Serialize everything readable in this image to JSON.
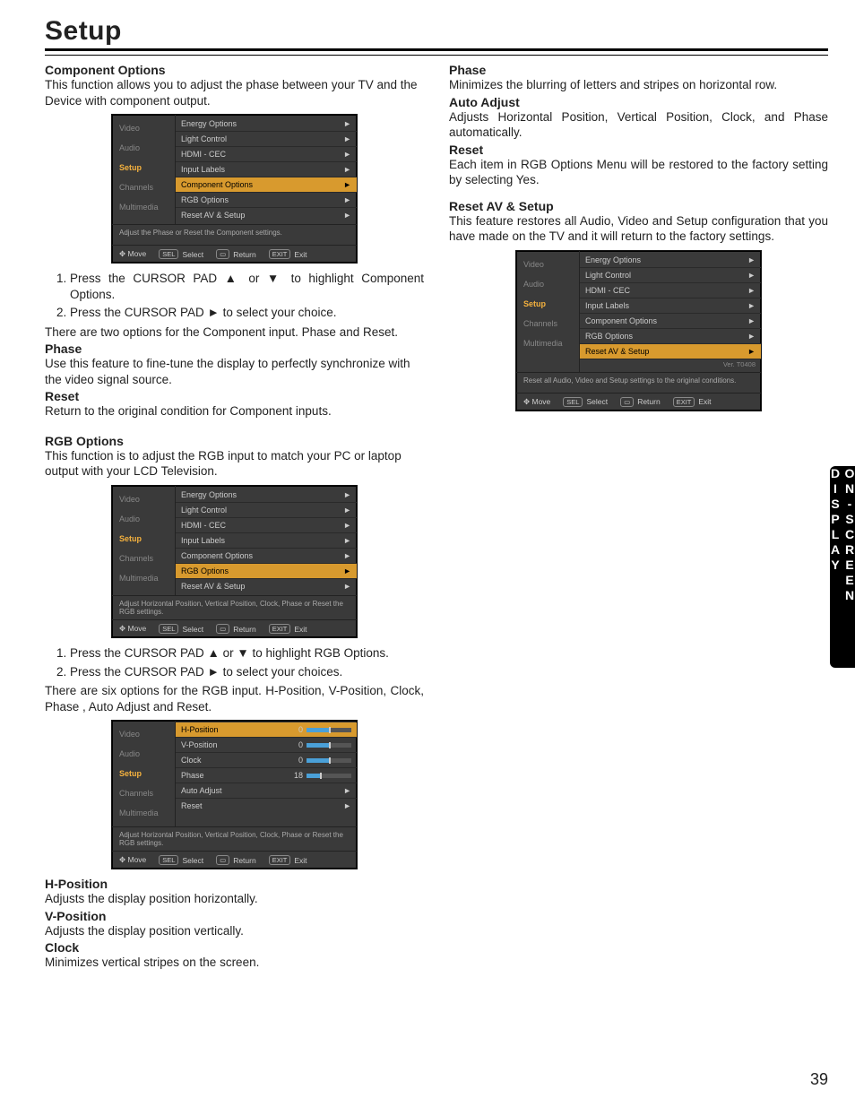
{
  "title": "Setup",
  "sideTab": "ON-SCREEN DISPLAY",
  "pageNumber": "39",
  "osdNav": {
    "move": "Move",
    "select": "Select",
    "return": "Return",
    "exit": "Exit",
    "keySel": "SEL",
    "keyExit": "EXIT"
  },
  "sideMenu": [
    "Video",
    "Audio",
    "Setup",
    "Channels",
    "Multimedia"
  ],
  "setupItems": [
    "Energy Options",
    "Light Control",
    "HDMI - CEC",
    "Input Labels",
    "Component Options",
    "RGB Options",
    "Reset AV & Setup"
  ],
  "rgbPanel": {
    "rows": [
      {
        "label": "H-Position",
        "value": "0",
        "fill": 50
      },
      {
        "label": "V-Position",
        "value": "0",
        "fill": 50
      },
      {
        "label": "Clock",
        "value": "0",
        "fill": 50
      },
      {
        "label": "Phase",
        "value": "18",
        "fill": 30
      }
    ],
    "arrowRows": [
      "Auto Adjust",
      "Reset"
    ]
  },
  "desc": {
    "component": "Adjust the Phase or Reset the Component settings.",
    "rgb": "Adjust Horizontal Position, Vertical Position, Clock, Phase or Reset the RGB settings.",
    "reset": "Reset all Audio, Video and Setup settings to the original conditions.",
    "version": "Ver. T0408"
  },
  "left": {
    "compOpt": {
      "h": "Component Options",
      "p": "This function allows you to adjust the phase between your TV  and the Device with component output."
    },
    "compSteps": [
      "Press the CURSOR PAD ▲ or ▼ to highlight Component Options.",
      "Press the CURSOR PAD ► to select your choice."
    ],
    "compNote": "There are two options for the Component input. Phase and Reset.",
    "phase": {
      "h": "Phase",
      "p": "Use this feature to fine-tune the display to perfectly synchronize with the video signal source."
    },
    "reset": {
      "h": "Reset",
      "p": "Return to the  original condition for Component inputs."
    },
    "rgbOpt": {
      "h": "RGB Options",
      "p": "This function is to adjust the RGB input to match your PC or laptop output with your LCD Television."
    },
    "rgbSteps": [
      "Press the CURSOR PAD ▲ or ▼ to highlight RGB Options.",
      "Press the CURSOR PAD ► to select your choices."
    ],
    "rgbNote": "There are six options for the RGB input. H-Position, V-Position, Clock, Phase , Auto Adjust and Reset.",
    "hpos": {
      "h": "H-Position",
      "p": "Adjusts the display position horizontally."
    },
    "vpos": {
      "h": "V-Position",
      "p": "Adjusts the display position vertically."
    },
    "clock": {
      "h": "Clock",
      "p": "Minimizes vertical stripes on the screen."
    }
  },
  "right": {
    "phase": {
      "h": "Phase",
      "p": "Minimizes the blurring of letters and stripes on horizontal row."
    },
    "auto": {
      "h": "Auto Adjust",
      "p": "Adjusts Horizontal Position, Vertical Position, Clock, and Phase automatically."
    },
    "reset": {
      "h": "Reset",
      "p": "Each item in RGB Options Menu will be restored to the factory setting by selecting Yes."
    },
    "resetAV": {
      "h": "Reset AV & Setup",
      "p": "This feature restores all Audio, Video and Setup configuration that you have made on the TV and it will return to the factory settings."
    }
  }
}
